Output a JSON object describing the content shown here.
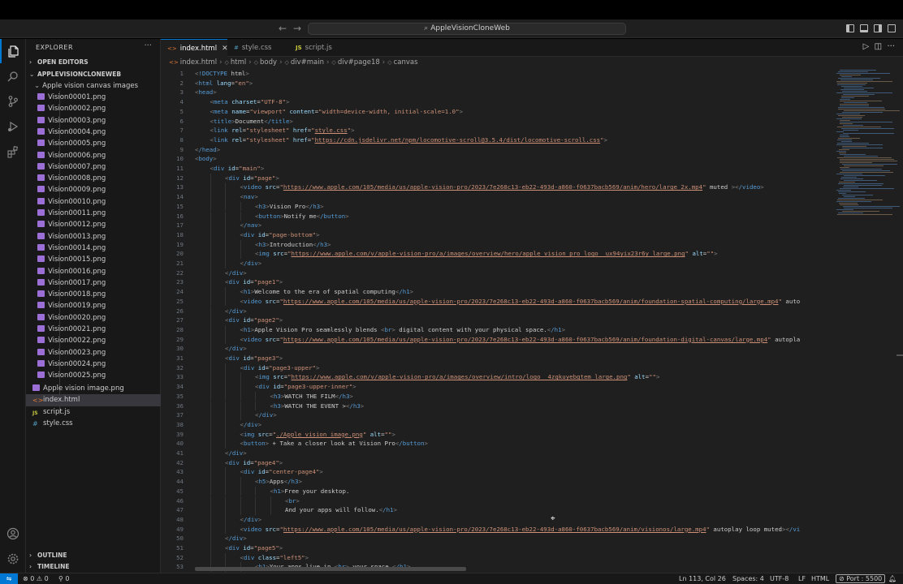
{
  "titlebar": {
    "back_icon": "arrow-left-icon",
    "forward_icon": "arrow-right-icon",
    "command_center": "AppleVisionCloneWeb"
  },
  "activitybar": [
    "explorer-icon",
    "search-icon",
    "source-control-icon",
    "run-debug-icon",
    "extensions-icon",
    "account-icon",
    "manage-gear-icon"
  ],
  "sidebar": {
    "title": "EXPLORER",
    "more": "···",
    "open_editors": "OPEN EDITORS",
    "project": "APPLEVISIONCLONEWEB",
    "folder": "Apple vision canvas images",
    "images": [
      "Vision00001.png",
      "Vision00002.png",
      "Vision00003.png",
      "Vision00004.png",
      "Vision00005.png",
      "Vision00006.png",
      "Vision00007.png",
      "Vision00008.png",
      "Vision00009.png",
      "Vision00010.png",
      "Vision00011.png",
      "Vision00012.png",
      "Vision00013.png",
      "Vision00014.png",
      "Vision00015.png",
      "Vision00016.png",
      "Vision00017.png",
      "Vision00018.png",
      "Vision00019.png",
      "Vision00020.png",
      "Vision00021.png",
      "Vision00022.png",
      "Vision00023.png",
      "Vision00024.png",
      "Vision00025.png"
    ],
    "root_files": [
      {
        "name": "Apple vision image.png",
        "type": "png"
      },
      {
        "name": "index.html",
        "type": "html"
      },
      {
        "name": "script.js",
        "type": "js"
      },
      {
        "name": "style.css",
        "type": "css"
      }
    ],
    "outline": "OUTLINE",
    "timeline": "TIMELINE"
  },
  "tabs": [
    {
      "label": "index.html",
      "icon": "<>",
      "active": true
    },
    {
      "label": "style.css",
      "icon": "#",
      "active": false
    },
    {
      "label": "script.js",
      "icon": "JS",
      "active": false
    }
  ],
  "breadcrumb": [
    "index.html",
    "html",
    "body",
    "div#main",
    "div#page18",
    "canvas"
  ],
  "editor": {
    "lines": [
      {
        "n": "1",
        "i": 0,
        "t": "<!DOCTYPE html>"
      },
      {
        "n": "2",
        "i": 0,
        "t": "<html lang=\"en\">"
      },
      {
        "n": "3",
        "i": 0,
        "t": "<head>"
      },
      {
        "n": "4",
        "i": 1,
        "t": "<meta charset=\"UTF-8\">"
      },
      {
        "n": "5",
        "i": 1,
        "t": "<meta name=\"viewport\" content=\"width=device-width, initial-scale=1.0\">"
      },
      {
        "n": "6",
        "i": 1,
        "t": "<title>Document</title>"
      },
      {
        "n": "7",
        "i": 1,
        "t": "<link rel=\"stylesheet\" href=\"style.css\">"
      },
      {
        "n": "8",
        "i": 1,
        "t": "<link rel=\"stylesheet\" href=\"https://cdn.jsdelivr.net/npm/locomotive-scroll@3.5.4/dist/locomotive-scroll.css\">"
      },
      {
        "n": "9",
        "i": 0,
        "t": "</head>"
      },
      {
        "n": "10",
        "i": 0,
        "t": "<body>"
      },
      {
        "n": "11",
        "i": 1,
        "t": "<div id=\"main\">"
      },
      {
        "n": "12",
        "i": 2,
        "t": "<div id=\"page\">"
      },
      {
        "n": "13",
        "i": 3,
        "t": "<video src=\"https://www.apple.com/105/media/us/apple-vision-pro/2023/7e268c13-eb22-493d-a860-f0637bacb569/anim/hero/large_2x.mp4\" muted ></video>"
      },
      {
        "n": "14",
        "i": 3,
        "t": "<nav>"
      },
      {
        "n": "15",
        "i": 4,
        "t": "<h3>Vision Pro</h3>"
      },
      {
        "n": "16",
        "i": 4,
        "t": "<button>Notify me</button>"
      },
      {
        "n": "17",
        "i": 3,
        "t": "</nav>"
      },
      {
        "n": "18",
        "i": 3,
        "t": "<div id=\"page-bottom\">"
      },
      {
        "n": "19",
        "i": 4,
        "t": "<h3>Introduction</h3>"
      },
      {
        "n": "20",
        "i": 4,
        "t": "<img src=\"https://www.apple.com/v/apple-vision-pro/a/images/overview/hero/apple_vision_pro_logo__ux94yix23r6y_large.png\" alt=\"\">"
      },
      {
        "n": "21",
        "i": 3,
        "t": "</div>"
      },
      {
        "n": "22",
        "i": 2,
        "t": "</div>"
      },
      {
        "n": "23",
        "i": 2,
        "t": "<div id=\"page1\">"
      },
      {
        "n": "24",
        "i": 3,
        "t": "<h1>Welcome to the era of spatial computing</h1>"
      },
      {
        "n": "25",
        "i": 3,
        "t": "<video src=\"https://www.apple.com/105/media/us/apple-vision-pro/2023/7e268c13-eb22-493d-a860-f0637bacb569/anim/foundation-spatial-computing/large.mp4\" auto"
      },
      {
        "n": "26",
        "i": 2,
        "t": "</div>"
      },
      {
        "n": "27",
        "i": 2,
        "t": "<div id=\"page2\">"
      },
      {
        "n": "28",
        "i": 3,
        "t": "<h1>Apple Vision Pro seamlessly blends <br> digital content with your physical space.</h1>"
      },
      {
        "n": "29",
        "i": 3,
        "t": "<video src=\"https://www.apple.com/105/media/us/apple-vision-pro/2023/7e268c13-eb22-493d-a860-f0637bacb569/anim/foundation-digital-canvas/large.mp4\" autopla"
      },
      {
        "n": "30",
        "i": 2,
        "t": "</div>"
      },
      {
        "n": "31",
        "i": 2,
        "t": "<div id=\"page3\">"
      },
      {
        "n": "32",
        "i": 3,
        "t": "<div id=\"page3-upper\">"
      },
      {
        "n": "33",
        "i": 4,
        "t": "<img src=\"https://www.apple.com/v/apple-vision-pro/a/images/overview/intro/logo__4zgkuyebgtem_large.png\" alt=\"\">"
      },
      {
        "n": "34",
        "i": 4,
        "t": "<div id=\"page3-upper-inner\">"
      },
      {
        "n": "35",
        "i": 5,
        "t": "<h3>WATCH THE FILM</h3>"
      },
      {
        "n": "36",
        "i": 5,
        "t": "<h3>WATCH THE EVENT ></h3>"
      },
      {
        "n": "37",
        "i": 4,
        "t": "</div>"
      },
      {
        "n": "38",
        "i": 3,
        "t": "</div>"
      },
      {
        "n": "39",
        "i": 3,
        "t": "<img src=\"./Apple vision image.png\" alt=\"\">"
      },
      {
        "n": "40",
        "i": 3,
        "t": "<button> + Take a closer look at Vision Pro</button>"
      },
      {
        "n": "41",
        "i": 2,
        "t": "</div>"
      },
      {
        "n": "42",
        "i": 2,
        "t": "<div id=\"page4\">"
      },
      {
        "n": "43",
        "i": 3,
        "t": "<div id=\"center-page4\">"
      },
      {
        "n": "44",
        "i": 4,
        "t": "<h5>Apps</h3>"
      },
      {
        "n": "45",
        "i": 5,
        "t": "<h1>Free your desktop."
      },
      {
        "n": "46",
        "i": 6,
        "t": "<br>"
      },
      {
        "n": "47",
        "i": 6,
        "t": "And your apps will follow.</h1>"
      },
      {
        "n": "48",
        "i": 3,
        "t": "</div>"
      },
      {
        "n": "49",
        "i": 3,
        "t": "<video src=\"https://www.apple.com/105/media/us/apple-vision-pro/2023/7e268c13-eb22-493d-a860-f0637bacb569/anim/visionos/large.mp4\" autoplay loop muted></vi"
      },
      {
        "n": "50",
        "i": 2,
        "t": "</div>"
      },
      {
        "n": "51",
        "i": 2,
        "t": "<div id=\"page5\">"
      },
      {
        "n": "52",
        "i": 3,
        "t": "<div class=\"left5\">"
      },
      {
        "n": "53",
        "i": 4,
        "t": "<h1>Your apps live in <br> your space.</h1>"
      }
    ]
  },
  "statusbar": {
    "remote_icon": "remote-icon",
    "problems": "⊗ 0 ⚠ 0",
    "ports": "⚲ 0",
    "cursor_pos": "Ln 113, Col 26",
    "spaces": "Spaces: 4",
    "encoding": "UTF-8",
    "eol": "LF",
    "language": "HTML",
    "port": "⊘ Port : 5500",
    "bell_icon": "bell-icon"
  },
  "colors": {
    "accent": "#0078d4",
    "tag": "#569cd6",
    "attr": "#9cdcfe",
    "string": "#ce9178"
  }
}
